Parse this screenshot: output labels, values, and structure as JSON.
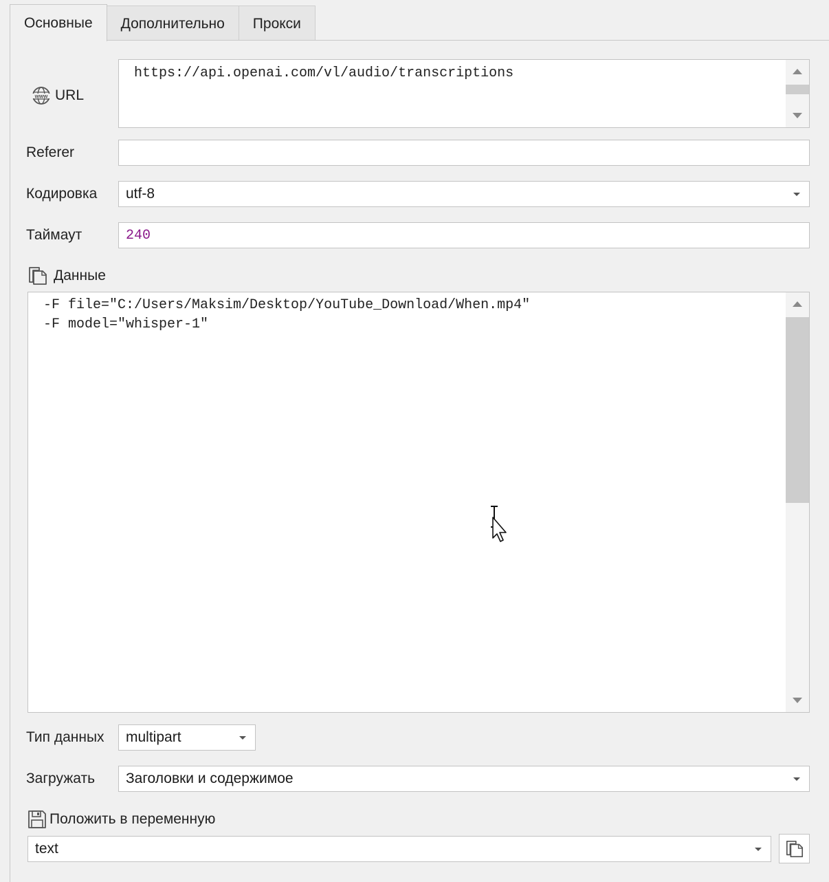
{
  "tabs": [
    {
      "label": "Основные",
      "active": true
    },
    {
      "label": "Дополнительно",
      "active": false
    },
    {
      "label": "Прокси",
      "active": false
    }
  ],
  "url": {
    "label": "URL",
    "icon": "www-globe-icon",
    "value": "https://api.openai.com/vl/audio/transcriptions"
  },
  "referer": {
    "label": "Referer",
    "value": ""
  },
  "encoding": {
    "label": "Кодировка",
    "value": "utf-8"
  },
  "timeout": {
    "label": "Таймаут",
    "value": "240",
    "value_color": "#8b1a8b"
  },
  "data": {
    "label": "Данные",
    "icon": "copy-icon",
    "lines": [
      "-F file=\"C:/Users/Maksim/Desktop/YouTube_Download/When.mp4\"",
      "-F model=\"whisper-1\""
    ]
  },
  "data_type": {
    "label": "Тип данных",
    "value": "multipart"
  },
  "load": {
    "label": "Загружать",
    "value": "Заголовки и содержимое"
  },
  "save_to_variable": {
    "label": "Положить в переменную",
    "icon": "floppy-disk-icon",
    "value": "text",
    "button_icon": "copy-icon"
  },
  "colors": {
    "background": "#f0f0f0",
    "field_border": "#c3c3c3",
    "timeout_value": "#8b1a8b"
  }
}
